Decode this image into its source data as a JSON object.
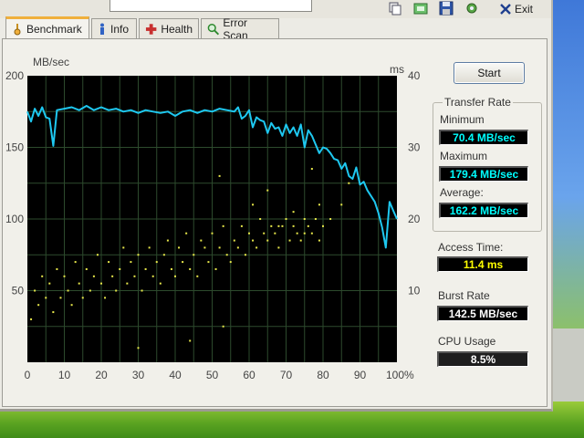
{
  "tabs": [
    {
      "label": "Benchmark",
      "icon": "gauge-icon",
      "active": true
    },
    {
      "label": "Info",
      "icon": "info-icon",
      "active": false
    },
    {
      "label": "Health",
      "icon": "health-cross-icon",
      "active": false
    },
    {
      "label": "Error Scan",
      "icon": "magnifier-icon",
      "active": false
    }
  ],
  "toolbar": {
    "icons": [
      "copy-icon",
      "screenshot-icon",
      "save-icon",
      "options-icon"
    ],
    "exit_label": "Exit"
  },
  "start_label": "Start",
  "stats": {
    "transfer_rate_title": "Transfer Rate",
    "minimum_label": "Minimum",
    "minimum_value": "70.4 MB/sec",
    "maximum_label": "Maximum",
    "maximum_value": "179.4 MB/sec",
    "average_label": "Average:",
    "average_value": "162.2 MB/sec",
    "access_time_label": "Access Time:",
    "access_time_value": "11.4 ms",
    "burst_rate_label": "Burst Rate",
    "burst_rate_value": "142.5 MB/sec",
    "cpu_usage_label": "CPU Usage",
    "cpu_usage_value": "8.5%"
  },
  "colors": {
    "plot_background": "#000000",
    "grid": "#2d4a2d",
    "transfer_line": "#1ec8f0",
    "access_points": "#e6e64a",
    "accent_tab": "#f0b03c"
  },
  "chart_data": {
    "type": "line",
    "ylabel_left": "MB/sec",
    "ylabel_right": "ms",
    "x_ticks": [
      "0",
      "10",
      "20",
      "30",
      "40",
      "50",
      "60",
      "70",
      "80",
      "90",
      "100%"
    ],
    "y_left_ticks": [
      "50",
      "100",
      "150",
      "200"
    ],
    "y_right_ticks": [
      "10",
      "20",
      "30",
      "40"
    ],
    "xlim": [
      0,
      100
    ],
    "ylim_left": [
      0,
      200
    ],
    "ylim_right": [
      0,
      40
    ],
    "grid": true,
    "series": [
      {
        "axis": "left",
        "x": [
          0,
          1,
          2,
          3,
          4,
          5,
          6,
          7,
          8,
          10,
          12,
          14,
          16,
          18,
          20,
          22,
          24,
          26,
          28,
          30,
          32,
          34,
          36,
          38,
          40,
          42,
          44,
          46,
          48,
          50,
          52,
          54,
          56,
          57,
          58,
          59,
          60,
          61,
          62,
          63,
          64,
          65,
          66,
          67,
          68,
          69,
          70,
          71,
          72,
          73,
          74,
          75,
          76,
          77,
          78,
          79,
          80,
          81,
          82,
          83,
          84,
          85,
          86,
          87,
          88,
          89,
          90,
          91,
          92,
          93,
          94,
          95,
          96,
          97,
          98,
          99,
          100
        ],
        "values": [
          175,
          168,
          177,
          172,
          178,
          171,
          170,
          151,
          176,
          177,
          178,
          176,
          179,
          176,
          178,
          176,
          177,
          175,
          176,
          174,
          176,
          175,
          174,
          175,
          172,
          175,
          176,
          174,
          176,
          175,
          177,
          176,
          175,
          178,
          170,
          172,
          176,
          164,
          171,
          169,
          168,
          160,
          167,
          163,
          164,
          158,
          166,
          160,
          164,
          158,
          166,
          150,
          162,
          158,
          152,
          146,
          150,
          149,
          146,
          142,
          141,
          135,
          139,
          130,
          128,
          136,
          124,
          126,
          120,
          116,
          112,
          104,
          94,
          80,
          112,
          106,
          100
        ]
      },
      {
        "axis": "right",
        "x": [
          1,
          2,
          3,
          4,
          5,
          6,
          7,
          8,
          9,
          10,
          11,
          12,
          13,
          14,
          15,
          16,
          17,
          18,
          19,
          20,
          21,
          22,
          23,
          24,
          25,
          26,
          27,
          28,
          29,
          30,
          31,
          32,
          33,
          34,
          35,
          36,
          37,
          38,
          39,
          40,
          41,
          42,
          43,
          44,
          45,
          46,
          47,
          48,
          49,
          50,
          51,
          52,
          53,
          54,
          55,
          56,
          57,
          58,
          59,
          60,
          61,
          62,
          63,
          64,
          65,
          66,
          67,
          68,
          69,
          70,
          71,
          72,
          73,
          74,
          75,
          76,
          77,
          78,
          79,
          80,
          52,
          61,
          68,
          72,
          75,
          79,
          82,
          85,
          44,
          53,
          30,
          65,
          77,
          87
        ],
        "values": [
          6,
          10,
          8,
          12,
          9,
          11,
          7,
          13,
          9,
          12,
          10,
          8,
          14,
          11,
          9,
          13,
          10,
          12,
          15,
          11,
          9,
          14,
          12,
          10,
          13,
          16,
          11,
          14,
          12,
          15,
          10,
          13,
          16,
          12,
          14,
          11,
          15,
          17,
          13,
          12,
          16,
          14,
          18,
          13,
          15,
          12,
          17,
          16,
          14,
          18,
          13,
          16,
          19,
          15,
          14,
          17,
          16,
          19,
          15,
          18,
          17,
          16,
          20,
          18,
          17,
          19,
          18,
          16,
          19,
          20,
          17,
          19,
          18,
          17,
          20,
          19,
          18,
          20,
          17,
          19,
          26,
          22,
          19,
          21,
          18,
          22,
          20,
          22,
          3,
          5,
          2,
          24,
          27,
          25
        ]
      }
    ]
  }
}
